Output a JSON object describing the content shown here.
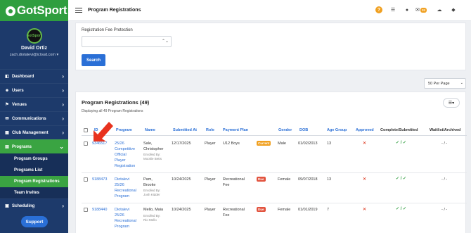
{
  "brand": {
    "logo_text": "GotSport",
    "avatar_text": "GotSport"
  },
  "profile": {
    "name": "David Ortiz",
    "email": "zach.diotalevi@icloud.com"
  },
  "sidebar": {
    "items": [
      {
        "label": "Dashboard",
        "icon": "dashboard-icon"
      },
      {
        "label": "Users",
        "icon": "users-icon"
      },
      {
        "label": "Venues",
        "icon": "venues-icon"
      },
      {
        "label": "Communications",
        "icon": "communications-icon"
      },
      {
        "label": "Club Management",
        "icon": "club-management-icon"
      },
      {
        "label": "Programs",
        "icon": "programs-icon"
      }
    ],
    "sub_items": [
      "Program Groups",
      "Programs List",
      "Program Registrations",
      "Team Invites"
    ],
    "scheduling": "Scheduling",
    "support": "Support"
  },
  "topbar": {
    "title": "Program Registrations",
    "badge": "99"
  },
  "filter": {
    "fee_label": "Registration Fee Protection",
    "fee_value": "",
    "search_label": "Search"
  },
  "per_page": "50 Per Page",
  "registrations": {
    "title": "Program Registrations (49)",
    "subtitle": "Displaying all 49 Program Registrations",
    "headers": [
      "ID",
      "Program",
      "Name",
      "Submitted At",
      "Role",
      "Payment Plan",
      "Gender",
      "DOB",
      "Age Group",
      "Approved",
      "Complete/Submitted",
      "Waitlist/Archived"
    ],
    "rows": [
      {
        "id": "9346517",
        "program": [
          "25/26",
          "Competitive",
          "Official",
          "Player",
          "Registration"
        ],
        "name": [
          "Sale,",
          "Christopher"
        ],
        "enrolled_by": [
          "Enrolled By:",
          "Mookie Betts"
        ],
        "submitted": "12/17/2025",
        "role": "Player",
        "payment_plan": [
          "U12 Boys"
        ],
        "status": "Current",
        "gender": "Male",
        "dob": "01/02/2013",
        "age_group": "13",
        "approved": "✕",
        "complete": "✓ / ✓",
        "waitlist": "- / -"
      },
      {
        "id": "9188473",
        "program": [
          "Diotalevi",
          "25/26",
          "Recreational",
          "Program"
        ],
        "name": [
          "Pam,",
          "Brooke"
        ],
        "enrolled_by": [
          "Enrolled By:",
          "Josh Kidder"
        ],
        "submitted": "10/24/2025",
        "role": "Player",
        "payment_plan": [
          "Recreational",
          "Fee"
        ],
        "status": "Due",
        "gender": "Female",
        "dob": "09/07/2018",
        "age_group": "13",
        "approved": "✕",
        "complete": "✓ / ✓",
        "waitlist": "- / -"
      },
      {
        "id": "9188440",
        "program": [
          "Diotalevi",
          "25/26",
          "Recreational",
          "Program"
        ],
        "name": [
          "Mello, Maia"
        ],
        "enrolled_by": [
          "Enrolled By:",
          "Rio Mello"
        ],
        "submitted": "10/24/2025",
        "role": "Player",
        "payment_plan": [
          "Recreational",
          "Fee"
        ],
        "status": "Due",
        "gender": "Female",
        "dob": "01/01/2019",
        "age_group": "7",
        "approved": "✕",
        "complete": "✓ / ✓",
        "waitlist": "- / -"
      }
    ]
  },
  "colors": {
    "sidebar": "#1d3a6b",
    "brand_green": "#2f9e3f",
    "accent_blue": "#2a6fd6",
    "annotation_arrow": "#e8321e"
  }
}
